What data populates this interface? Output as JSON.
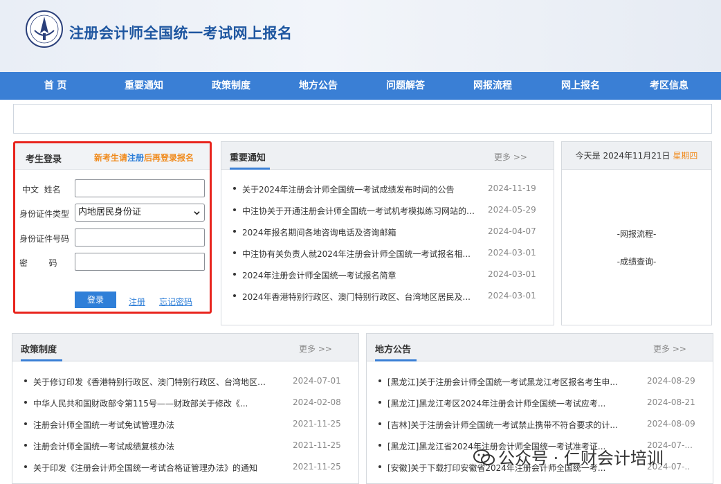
{
  "site": {
    "title": "注册会计师全国统一考试网上报名"
  },
  "nav": [
    "首 页",
    "重要通知",
    "政策制度",
    "地方公告",
    "问题解答",
    "网报流程",
    "网上报名",
    "考区信息"
  ],
  "login": {
    "title": "考生登录",
    "tip_prefix": "新考生请",
    "tip_link": "注册",
    "tip_suffix": "后再登录报名",
    "name_label": "中文  姓名",
    "id_type_label": "身份证件类型",
    "id_type_value": "内地居民身份证",
    "id_number_label": "身份证件号码",
    "password_label": "密        码",
    "name_value": "",
    "id_number_value": "",
    "password_value": "",
    "login_button": "登录",
    "register_link": "注册",
    "forgot_link": "忘记密码"
  },
  "notices": {
    "title": "重要通知",
    "more": "更多 >>",
    "items": [
      {
        "title": "关于2024年注册会计师全国统一考试成绩发布时间的公告",
        "date": "2024-11-19"
      },
      {
        "title": "中注协关于开通注册会计师全国统一考试机考模拟练习网站的公...",
        "date": "2024-05-29"
      },
      {
        "title": "2024年报名期间各地咨询电话及咨询邮箱",
        "date": "2024-04-07"
      },
      {
        "title": "中注协有关负责人就2024年注册会计师全国统一考试报名相...",
        "date": "2024-03-01"
      },
      {
        "title": "2024年注册会计师全国统一考试报名简章",
        "date": "2024-03-01"
      },
      {
        "title": "2024年香港特别行政区、澳门特别行政区、台湾地区居民及...",
        "date": "2024-03-01"
      }
    ]
  },
  "date_box": {
    "prefix": "今天是 2024年11月21日",
    "weekday": "星期四",
    "links": [
      "-网报流程-",
      "-成绩查询-"
    ]
  },
  "policy": {
    "title": "政策制度",
    "more": "更多 >>",
    "items": [
      {
        "title": "关于修订印发《香港特别行政区、澳门特别行政区、台湾地区居...",
        "date": "2024-07-01"
      },
      {
        "title": "中华人民共和国财政部令第115号——财政部关于修改《...",
        "date": "2024-02-08"
      },
      {
        "title": "注册会计师全国统一考试免试管理办法",
        "date": "2021-11-25"
      },
      {
        "title": "注册会计师全国统一考试成绩复核办法",
        "date": "2021-11-25"
      },
      {
        "title": "关于印发《注册会计师全国统一考试合格证管理办法》的通知",
        "date": "2021-11-25"
      }
    ]
  },
  "local": {
    "title": "地方公告",
    "more": "更多 >>",
    "items": [
      {
        "title": "[黑龙江]关于注册会计师全国统一考试黑龙江考区报名考生申...",
        "date": "2024-08-29"
      },
      {
        "title": "[黑龙江]黑龙江考区2024年注册会计师全国统一考试应考...",
        "date": "2024-08-21"
      },
      {
        "title": "[吉林]关于注册会计师全国统一考试禁止携带不符合要求的计...",
        "date": "2024-08-09"
      },
      {
        "title": "[黑龙江]黑龙江省2024年注册会计师全国统一考试准考证...",
        "date": "2024-07-..."
      },
      {
        "title": "[安徽]关于下载打印安徽省2024年注册会计师全国统一考...",
        "date": "2024-07-.."
      }
    ]
  },
  "watermark": {
    "text": "公众号 · 仁财会计培训"
  },
  "colors": {
    "nav": "#3a7fd5",
    "title": "#1e56a0",
    "highlight": "#e8241d",
    "accent": "#f08a1c",
    "link": "#2f7fd8"
  }
}
